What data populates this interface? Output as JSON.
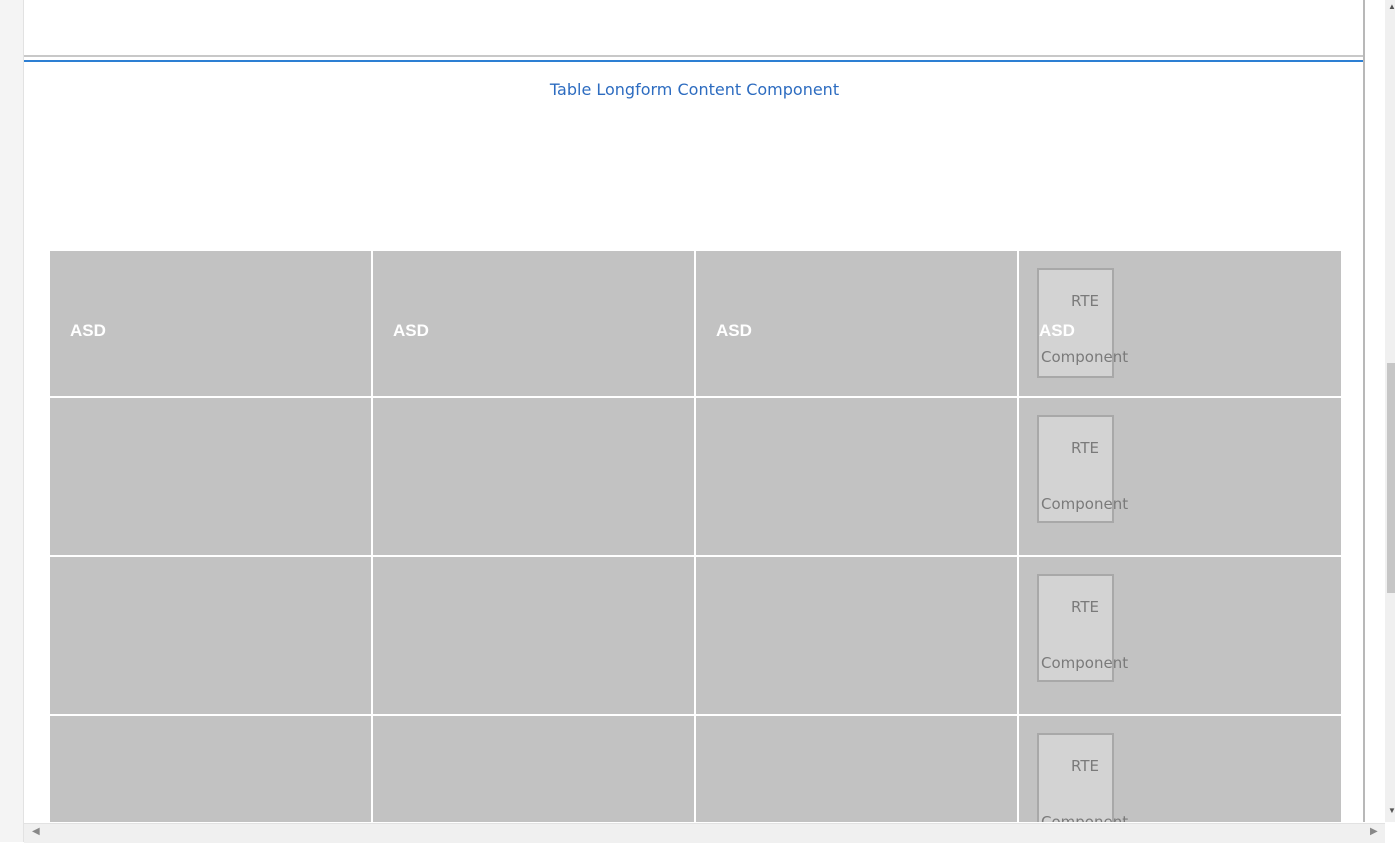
{
  "component": {
    "title": "Table Longform Content Component"
  },
  "table": {
    "header": [
      "ASD",
      "ASD",
      "ASD",
      "ASD"
    ],
    "rte_placeholder": {
      "line1": "RTE",
      "line2": "Component"
    }
  },
  "colors": {
    "accent": "#2d7fd3",
    "cell_bg": "#c2c2c2",
    "rte_bg": "#d3d3d3"
  }
}
